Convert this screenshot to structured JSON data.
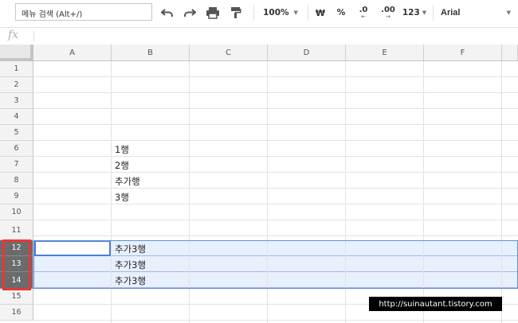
{
  "toolbar": {
    "search_label": "메뉴 검색 (Alt+/)",
    "zoom": "100%",
    "currency": "₩",
    "percent": "%",
    "decrease_decimal": ".0",
    "increase_decimal": ".00",
    "number_format": "123",
    "font": "Arial",
    "icons": [
      "undo-icon",
      "redo-icon",
      "print-icon",
      "paint-format-icon"
    ]
  },
  "formula_bar": {
    "fx_label": "fx"
  },
  "columns": [
    "A",
    "B",
    "C",
    "D",
    "E",
    "F"
  ],
  "rows": [
    "1",
    "2",
    "3",
    "4",
    "5",
    "6",
    "7",
    "8",
    "9",
    "10",
    "11",
    "12",
    "13",
    "14",
    "15",
    "16"
  ],
  "cells": {
    "B6": "1행",
    "B7": "2행",
    "B8": "추가행",
    "B9": "3행",
    "B12": "추가3행",
    "B13": "추가3행",
    "B14": "추가3행"
  },
  "selected_rows": [
    "12",
    "13",
    "14"
  ],
  "watermark": "http://suinautant.tistory.com",
  "colors": {
    "selection": "#e8f0fe",
    "selected_header": "#6b6b6b",
    "highlight_box": "#e53935"
  }
}
